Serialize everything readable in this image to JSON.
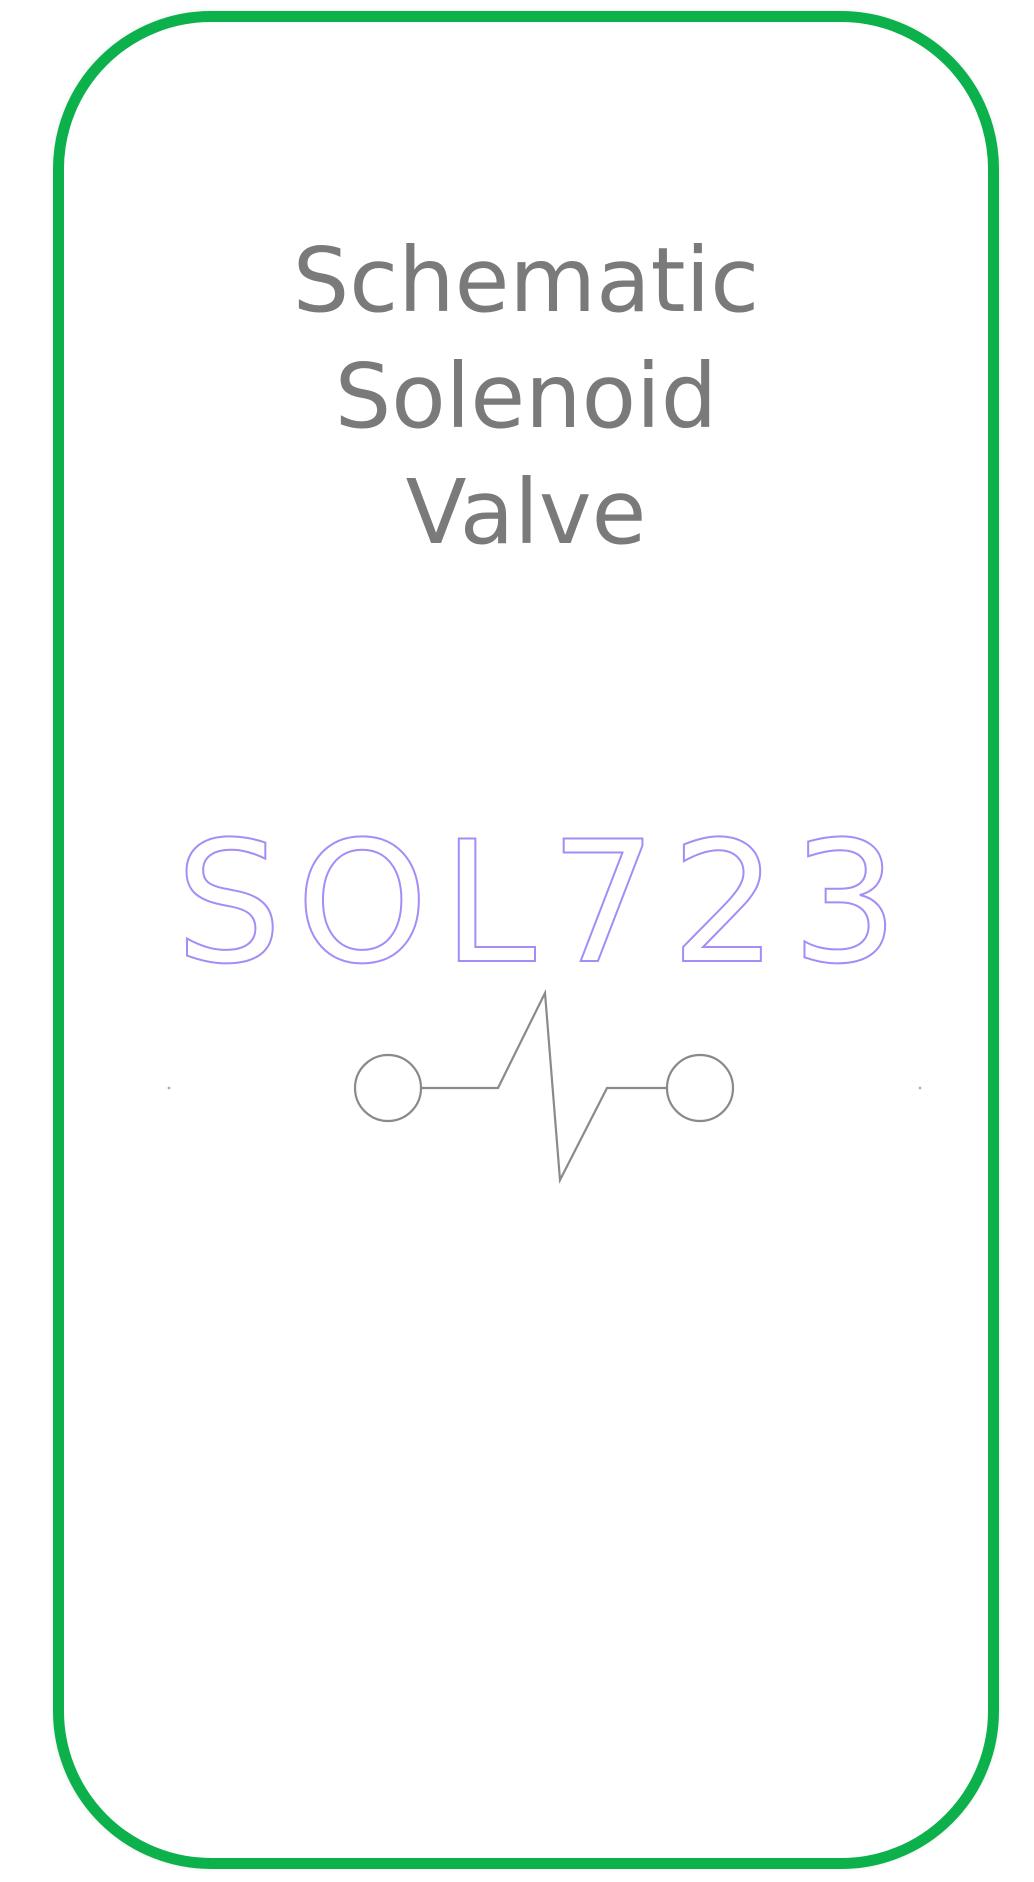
{
  "card": {
    "border_color": "#0cb14b"
  },
  "title": {
    "line1": "Schematic",
    "line2": "Solenoid",
    "line3": "Valve",
    "color": "#7a7a7a"
  },
  "symbol": {
    "tag": "SOL723",
    "tag_color": "#a58cf6",
    "wire_color": "#8a8a8a",
    "icon": "solenoid-valve-icon"
  }
}
